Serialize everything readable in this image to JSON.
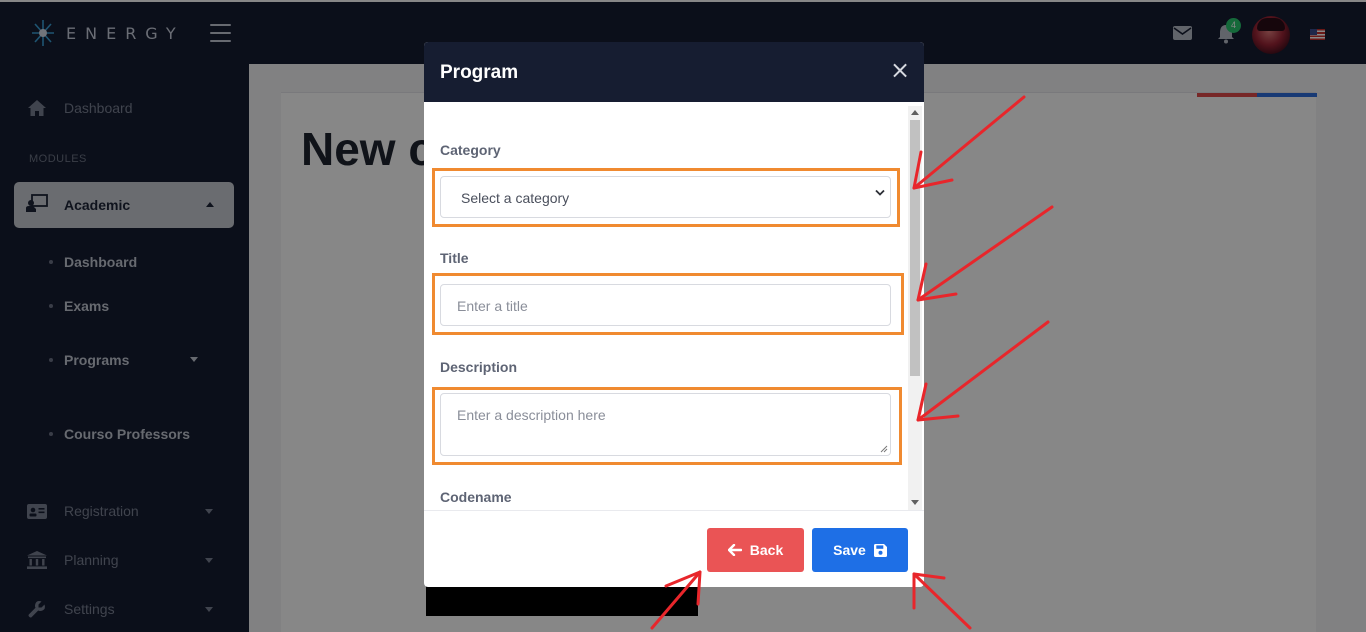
{
  "app": {
    "logo_text": "ENERGY",
    "notification_count": "4"
  },
  "sidebar": {
    "dashboard": "Dashboard",
    "section_title": "MODULES",
    "active": "Academic",
    "sub_items": [
      "Dashboard",
      "Exams",
      "Programs",
      "Courso Professors"
    ],
    "items": [
      "Registration",
      "Planning",
      "Settings"
    ]
  },
  "page": {
    "title": "New c"
  },
  "modal": {
    "title": "Program",
    "close": "×",
    "fields": {
      "category_label": "Category",
      "category_value": "Select a category",
      "title_label": "Title",
      "title_placeholder": "Enter a title",
      "description_label": "Description",
      "description_placeholder": "Enter a description here",
      "codename_label": "Codename"
    },
    "back_label": "Back",
    "save_label": "Save"
  },
  "colors": {
    "highlight": "#f08a30",
    "annotation_arrow": "#e8262b",
    "back": "#ea5455",
    "save": "#1e6fe6",
    "navy": "#161d31"
  }
}
